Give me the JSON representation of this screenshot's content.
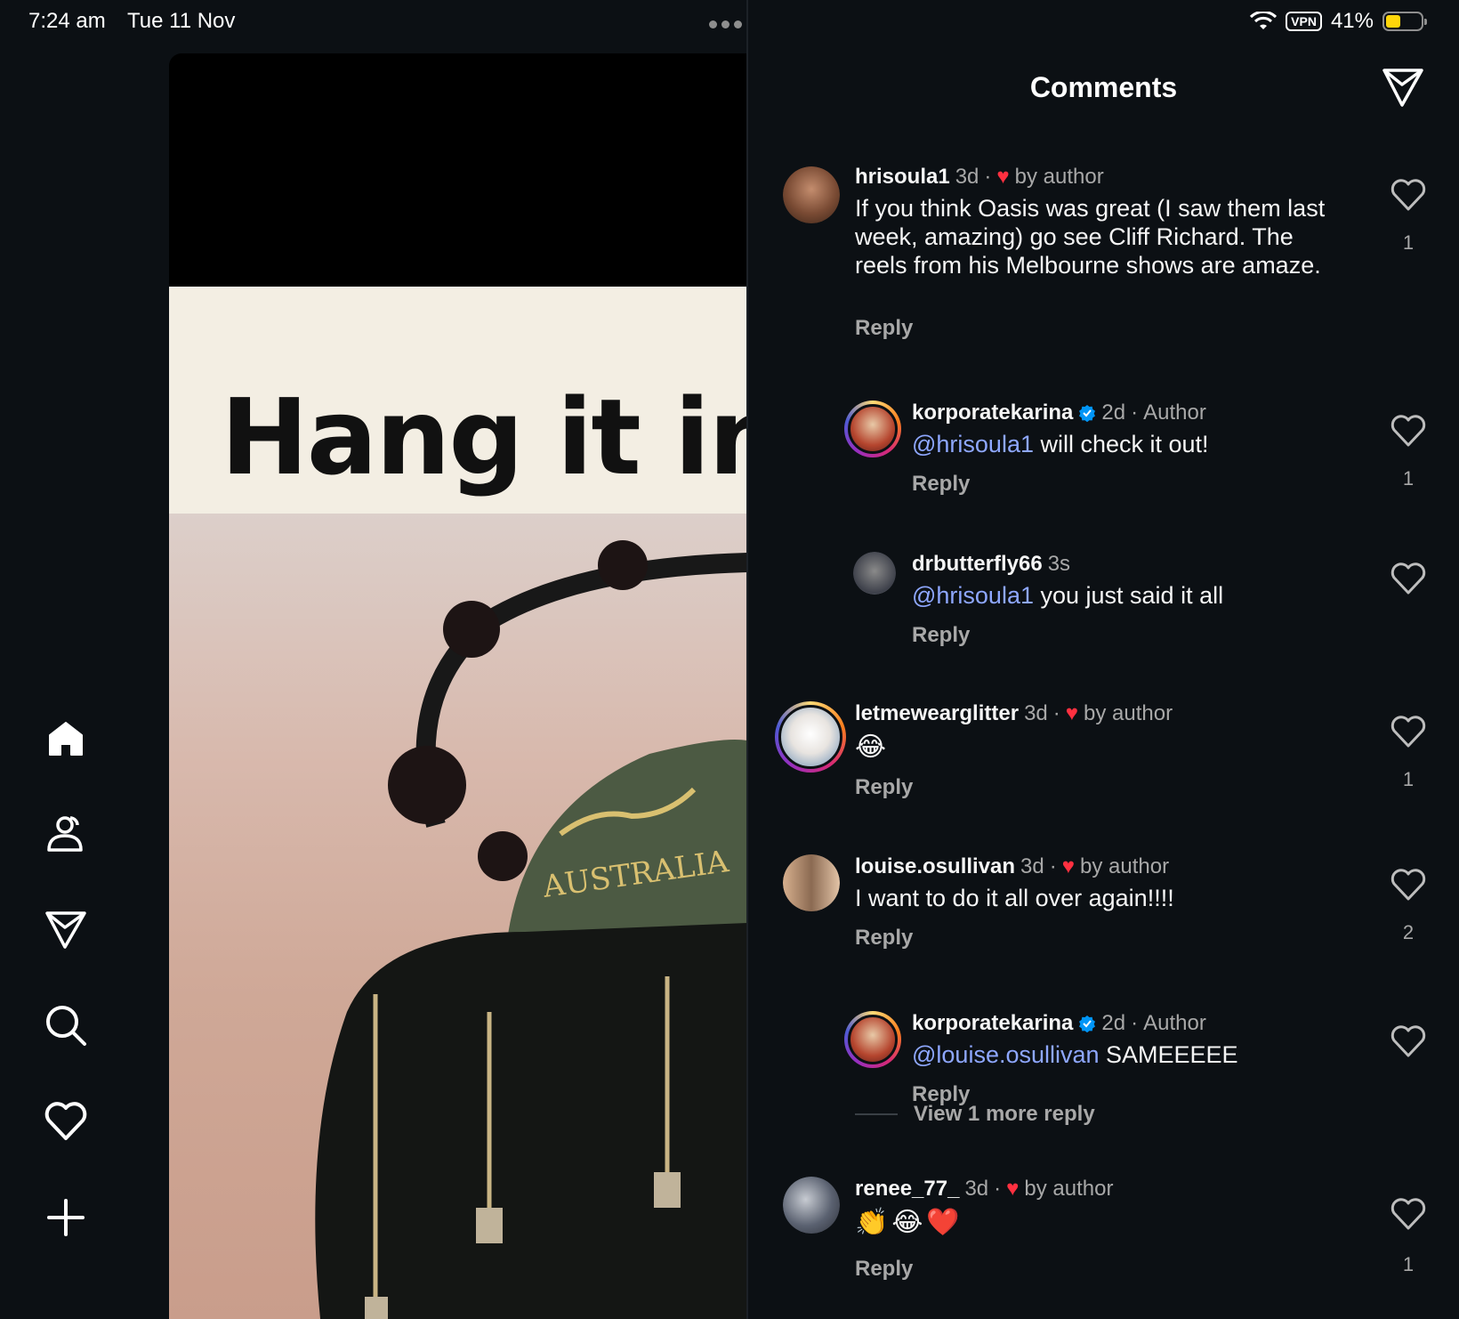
{
  "status": {
    "time": "7:24 am",
    "date": "Tue 11 Nov",
    "vpn": "VPN",
    "battery": "41%"
  },
  "post": {
    "headline": "Hang it in t",
    "hat_text": "AUSTRALIA"
  },
  "panel": {
    "title": "Comments"
  },
  "comments": [
    {
      "user": "hrisoula1",
      "time": "3d",
      "liked_by_author": "by author",
      "mention": "",
      "text": "If you think Oasis was great (I saw them last week, amazing) go see Cliff Richard. The reels from his Melbourne shows are amaze.",
      "reply": "Reply",
      "likes": "1"
    },
    {
      "user": "korporatekarina",
      "time": "2d",
      "role": "Author",
      "mention": "@hrisoula1",
      "text": " will check it out!",
      "reply": "Reply",
      "likes": "1"
    },
    {
      "user": "drbutterfly66",
      "time": "3s",
      "mention": "@hrisoula1",
      "text": " you just said it all",
      "reply": "Reply",
      "likes": ""
    },
    {
      "user": "letmewearglitter",
      "time": "3d",
      "liked_by_author": "by author",
      "mention": "",
      "text": "😂",
      "reply": "Reply",
      "likes": "1"
    },
    {
      "user": "louise.osullivan",
      "time": "3d",
      "liked_by_author": "by author",
      "mention": "",
      "text": "I want to do it all over again!!!!",
      "reply": "Reply",
      "likes": "2"
    },
    {
      "user": "korporatekarina",
      "time": "2d",
      "role": "Author",
      "mention": "@louise.osullivan",
      "text": " SAMEEEEE",
      "reply": "Reply",
      "likes": ""
    },
    {
      "user": "renee_77_",
      "time": "3d",
      "liked_by_author": "by author",
      "mention": "",
      "text": "👏😂❤️",
      "reply": "Reply",
      "likes": "1"
    }
  ],
  "view_more": "View 1 more reply",
  "separator": "·",
  "icons": {
    "home": "home-icon",
    "profile": "profile-icon",
    "messages": "paper-plane-icon",
    "search": "search-icon",
    "activity": "heart-icon",
    "create": "plus-icon"
  },
  "colors": {
    "background": "#0c1014",
    "mention": "#8ea7ff",
    "verified": "#0095f6",
    "heart": "#ff3040"
  }
}
